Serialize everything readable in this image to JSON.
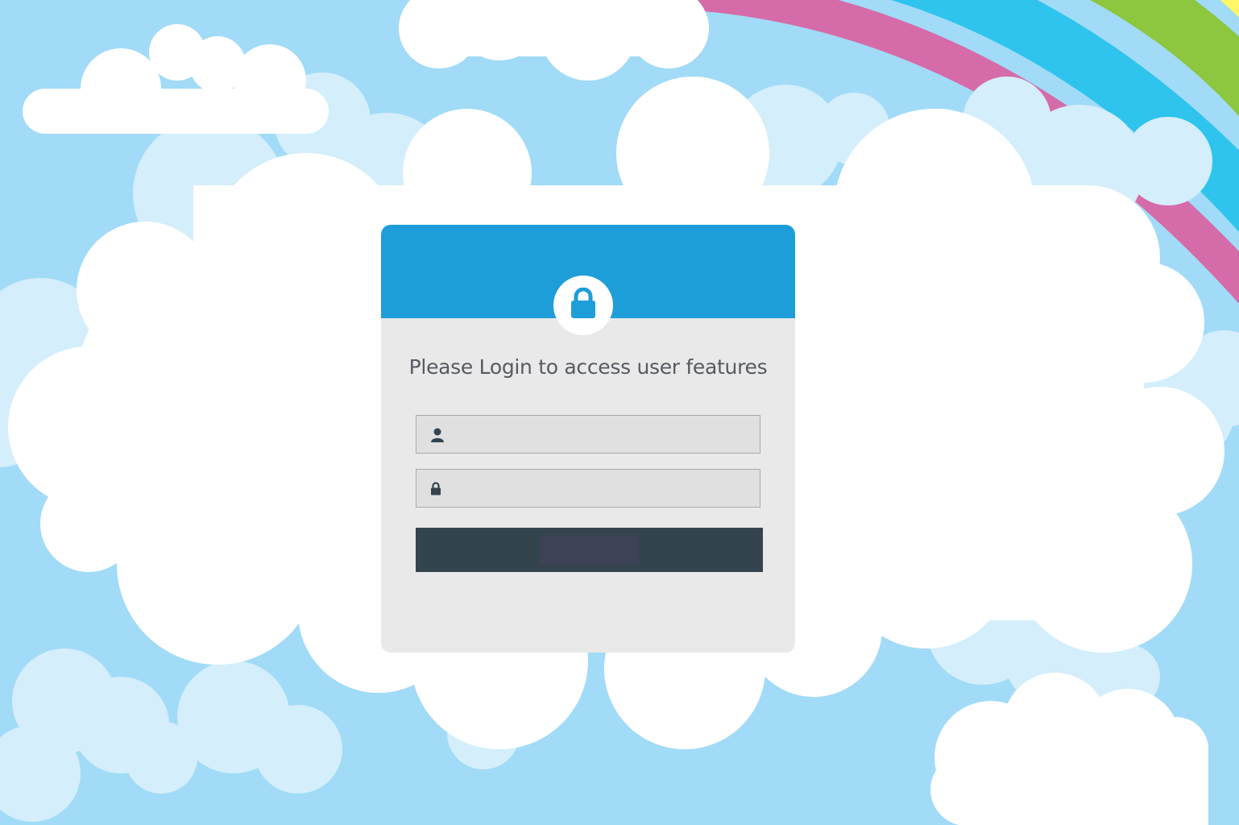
{
  "login": {
    "title": "Please Login to access user features",
    "username": {
      "value": "",
      "placeholder": "",
      "icon": "user-icon"
    },
    "password": {
      "value": "",
      "placeholder": "",
      "icon": "lock-icon"
    },
    "submit_label": "",
    "header_icon": "lock-icon"
  },
  "colors": {
    "sky": "#a1dbf7",
    "cloud": "#ffffff",
    "cloud_light": "#d4eefb",
    "header": "#1e9ed9",
    "card": "#e9e9e9",
    "field": "#e0e0e0",
    "button": "#34444f",
    "title_text": "#565a63",
    "rainbow": [
      "#d66ba9",
      "#2ec4ee",
      "#8dc63f",
      "#fef567",
      "#f58051"
    ]
  }
}
